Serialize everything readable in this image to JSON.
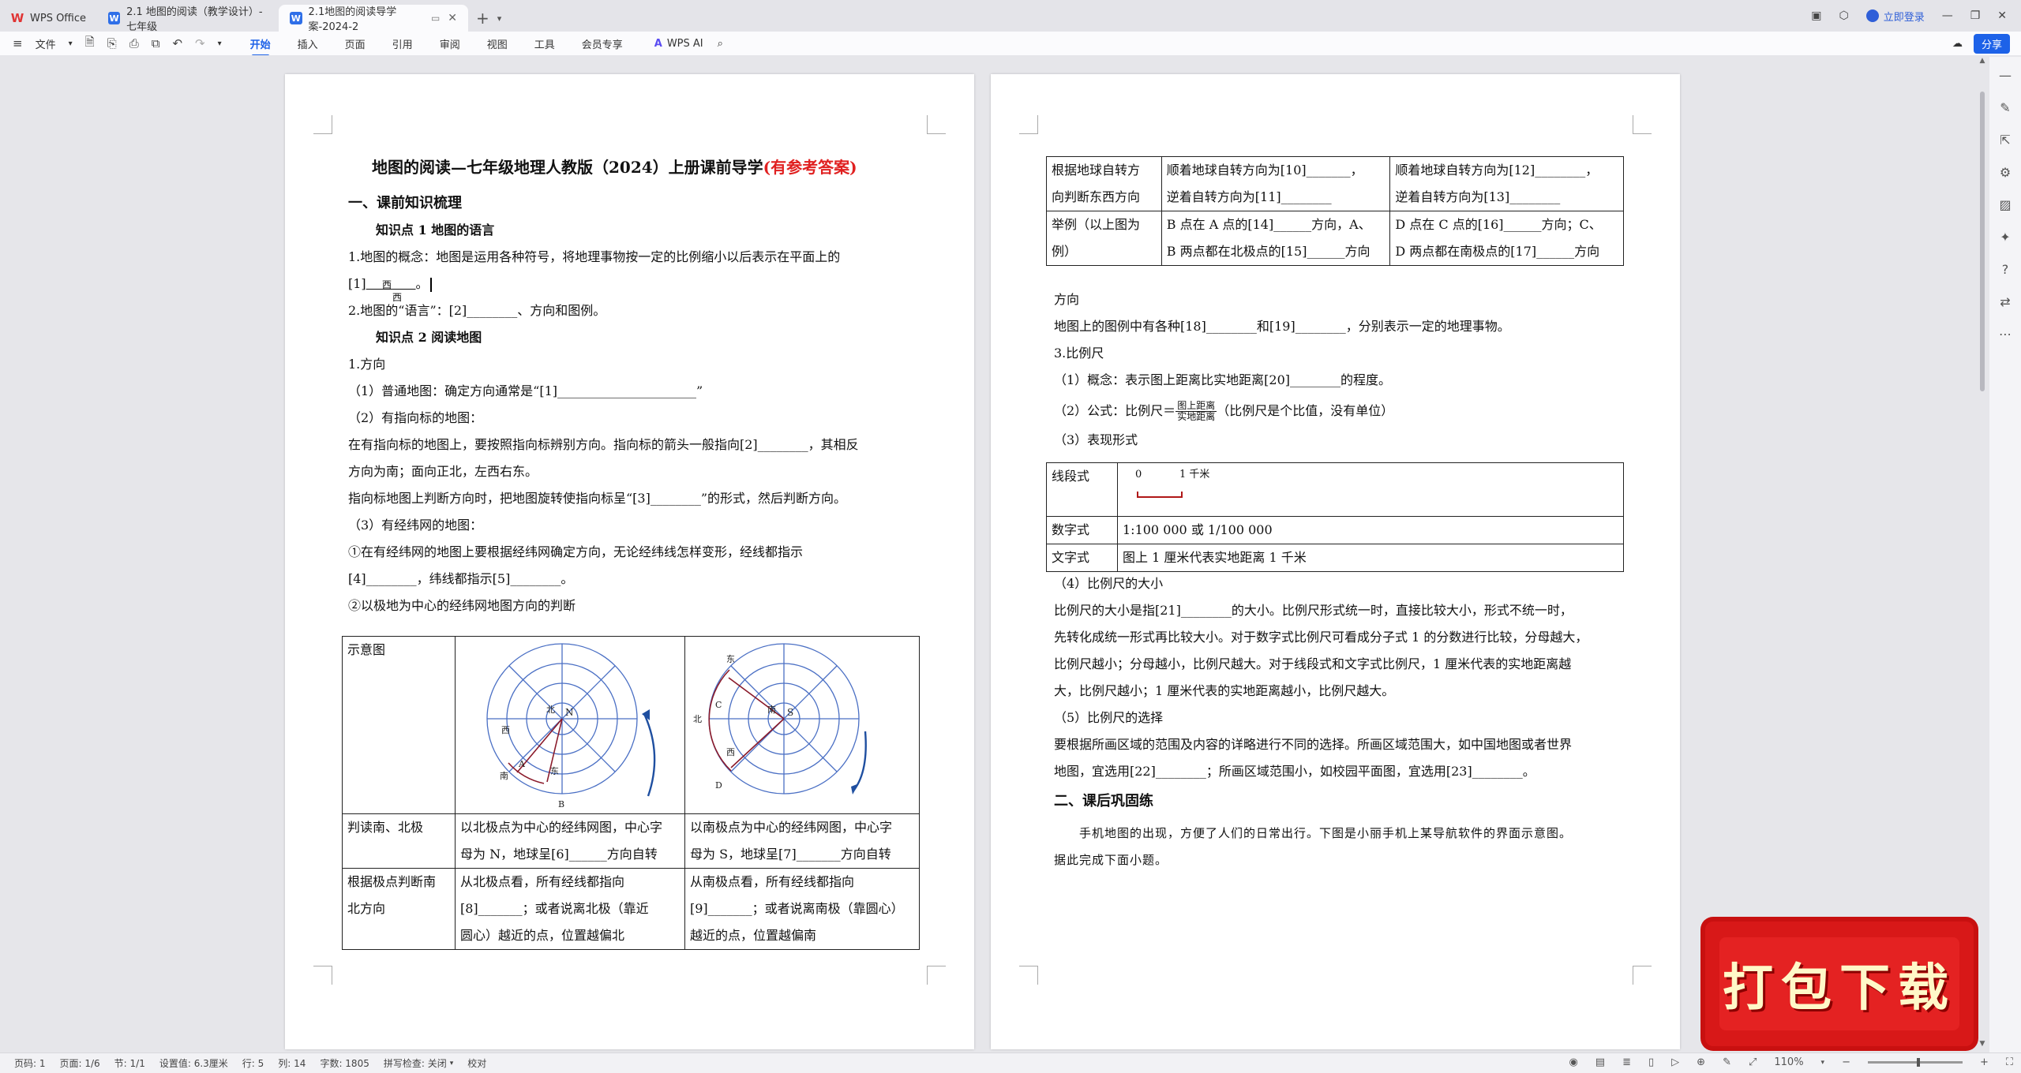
{
  "tabs": {
    "wps": "WPS Office",
    "doc1": "2.1 地图的阅读（教学设计）-七年级",
    "doc2": "2.1地图的阅读导学案-2024-2"
  },
  "titlebar": {
    "login": "立即登录"
  },
  "ribbon": {
    "file": "文件",
    "menus": [
      "开始",
      "插入",
      "页面",
      "引用",
      "审阅",
      "视图",
      "工具",
      "会员专享"
    ],
    "ai": "WPS AI",
    "share": "分享"
  },
  "page1": {
    "title_main": "地图的阅读—七年级地理人教版（2024）上册课前导学",
    "title_red": "(有参考答案)",
    "sec1": "一、课前知识梳理",
    "kp1": "知识点 1  地图的语言",
    "p1a": "1.地图的概念：地图是运用各种符号，将地理事物按一定的比例缩小以后表示在平面上的",
    "p1b_pre": "[1]",
    "p1b_blank": "西",
    "p1b_post": "。",
    "p1b_float": "西",
    "p2": "2.地图的“语言”：[2]________、方向和图例。",
    "kp2": "知识点 2  阅读地图",
    "d1": "1.方向",
    "d2": "（1）普通地图：确定方向通常是“[1]______________________”",
    "d3": "（2）有指向标的地图：",
    "d4": "在有指向标的地图上，要按照指向标辨别方向。指向标的箭头一般指向[2]________，其相反",
    "d5": "方向为南；面向正北，左西右东。",
    "d6": "指向标地图上判断方向时，把地图旋转使指向标呈“[3]________”的形式，然后判断方向。",
    "d7": "（3）有经纬网的地图：",
    "d8": "①在有经纬网的地图上要根据经纬网确定方向，无论经纬线怎样变形，经线都指示",
    "d9": "[4]________，纬线都指示[5]________。",
    "d10": "②以极地为中心的经纬网地图方向的判断",
    "table": {
      "r1c1": "示意图",
      "r2c1": "判读南、北极",
      "r2c2a": "以北极点为中心的经纬网图，中心字",
      "r2c2b": "母为 N，地球呈[6]______方向自转",
      "r2c3a": "以南极点为中心的经纬网图，中心字",
      "r2c3b": "母为 S，地球呈[7]_______方向自转",
      "r3c1a": "根据极点判断南",
      "r3c1b": "北方向",
      "r3c2a": "从北极点看，所有经线都指向",
      "r3c2b": "[8]_______；或者说离北极（靠近",
      "r3c2c": "圆心）越近的点，位置越偏北",
      "r3c3a": "从南极点看，所有经线都指向",
      "r3c3b": "[9]_______；或者说离南极（靠圆心）",
      "r3c3c": "越近的点，位置越偏南"
    },
    "globeN": {
      "center": "N",
      "ring": "北",
      "west": "西",
      "east": "东",
      "south": "南",
      "pa": "A",
      "pb": "B"
    },
    "globeS": {
      "center": "S",
      "ring": "南",
      "east": "东",
      "west": "西",
      "north": "北",
      "pc": "C",
      "pd": "D"
    }
  },
  "page2": {
    "t1": {
      "r1c1a": "根据地球自转方",
      "r1c1b": "向判断东西方向",
      "r1c2a": "顺着地球自转方向为[10]_______，",
      "r1c2b": "逆着自转方向为[11]________",
      "r1c3a": "顺着地球自转方向为[12]________，",
      "r1c3b": "逆着自转方向为[13]________",
      "r2c1a": "举例（以上图为",
      "r2c1b": "例）",
      "r2c2a": "B 点在 A 点的[14]______方向，A、",
      "r2c2b": "B 两点都在北极点的[15]______方向",
      "r2c3a": "D 点在 C 点的[16]______方向；C、",
      "r2c3b": "D 两点都在南极点的[17]______方向"
    },
    "l1": "方向",
    "l2": "地图上的图例中有各种[18]________和[19]________，分别表示一定的地理事物。",
    "l3": "3.比例尺",
    "l4": "（1）概念：表示图上距离比实地距离[20]________的程度。",
    "l5_pre": "（2）公式：比例尺＝",
    "frac_num": "图上距离",
    "frac_den": "实地距离",
    "l5_post": "（比例尺是个比值，没有单位）",
    "l6": "（3）表现形式",
    "t2": {
      "r1c1": "线段式",
      "scale0": "0",
      "scale1": "1 千米",
      "r2c1": "数字式",
      "r2c2": "1:100 000 或 1/100 000",
      "r3c1": "文字式",
      "r3c2": "图上 1 厘米代表实地距离 1 千米"
    },
    "l7": "（4）比例尺的大小",
    "l8": "比例尺的大小是指[21]________的大小。比例尺形式统一时，直接比较大小，形式不统一时，",
    "l9": "先转化成统一形式再比较大小。对于数字式比例尺可看成分子式 1 的分数进行比较，分母越大，",
    "l10": "比例尺越小；分母越小，比例尺越大。对于线段式和文字式比例尺，1 厘米代表的实地距离越",
    "l11": "大，比例尺越小；1 厘米代表的实地距离越小，比例尺越大。",
    "l12": "（5）比例尺的选择",
    "l13": "要根据所画区域的范围及内容的详略进行不同的选择。所画区域范围大，如中国地图或者世界",
    "l14": "地图，宜选用[22]________；所画区域范围小，如校园平面图，宜选用[23]________。",
    "sec2": "二、课后巩固练",
    "l15": "手机地图的出现，方便了人们的日常出行。下图是小丽手机上某导航软件的界面示意图。",
    "l16": "据此完成下面小题。"
  },
  "status": {
    "items": [
      "页码: 1",
      "页面: 1/6",
      "节: 1/1",
      "设置值: 6.3厘米",
      "行: 5",
      "列: 14",
      "字数: 1805",
      "拼写检查: 关闭",
      "校对"
    ],
    "zoom": "110%"
  },
  "banner": "打包下载",
  "colors": {
    "accent": "#1d62e8",
    "red_title": "#e02020",
    "banner": "#d81818"
  }
}
